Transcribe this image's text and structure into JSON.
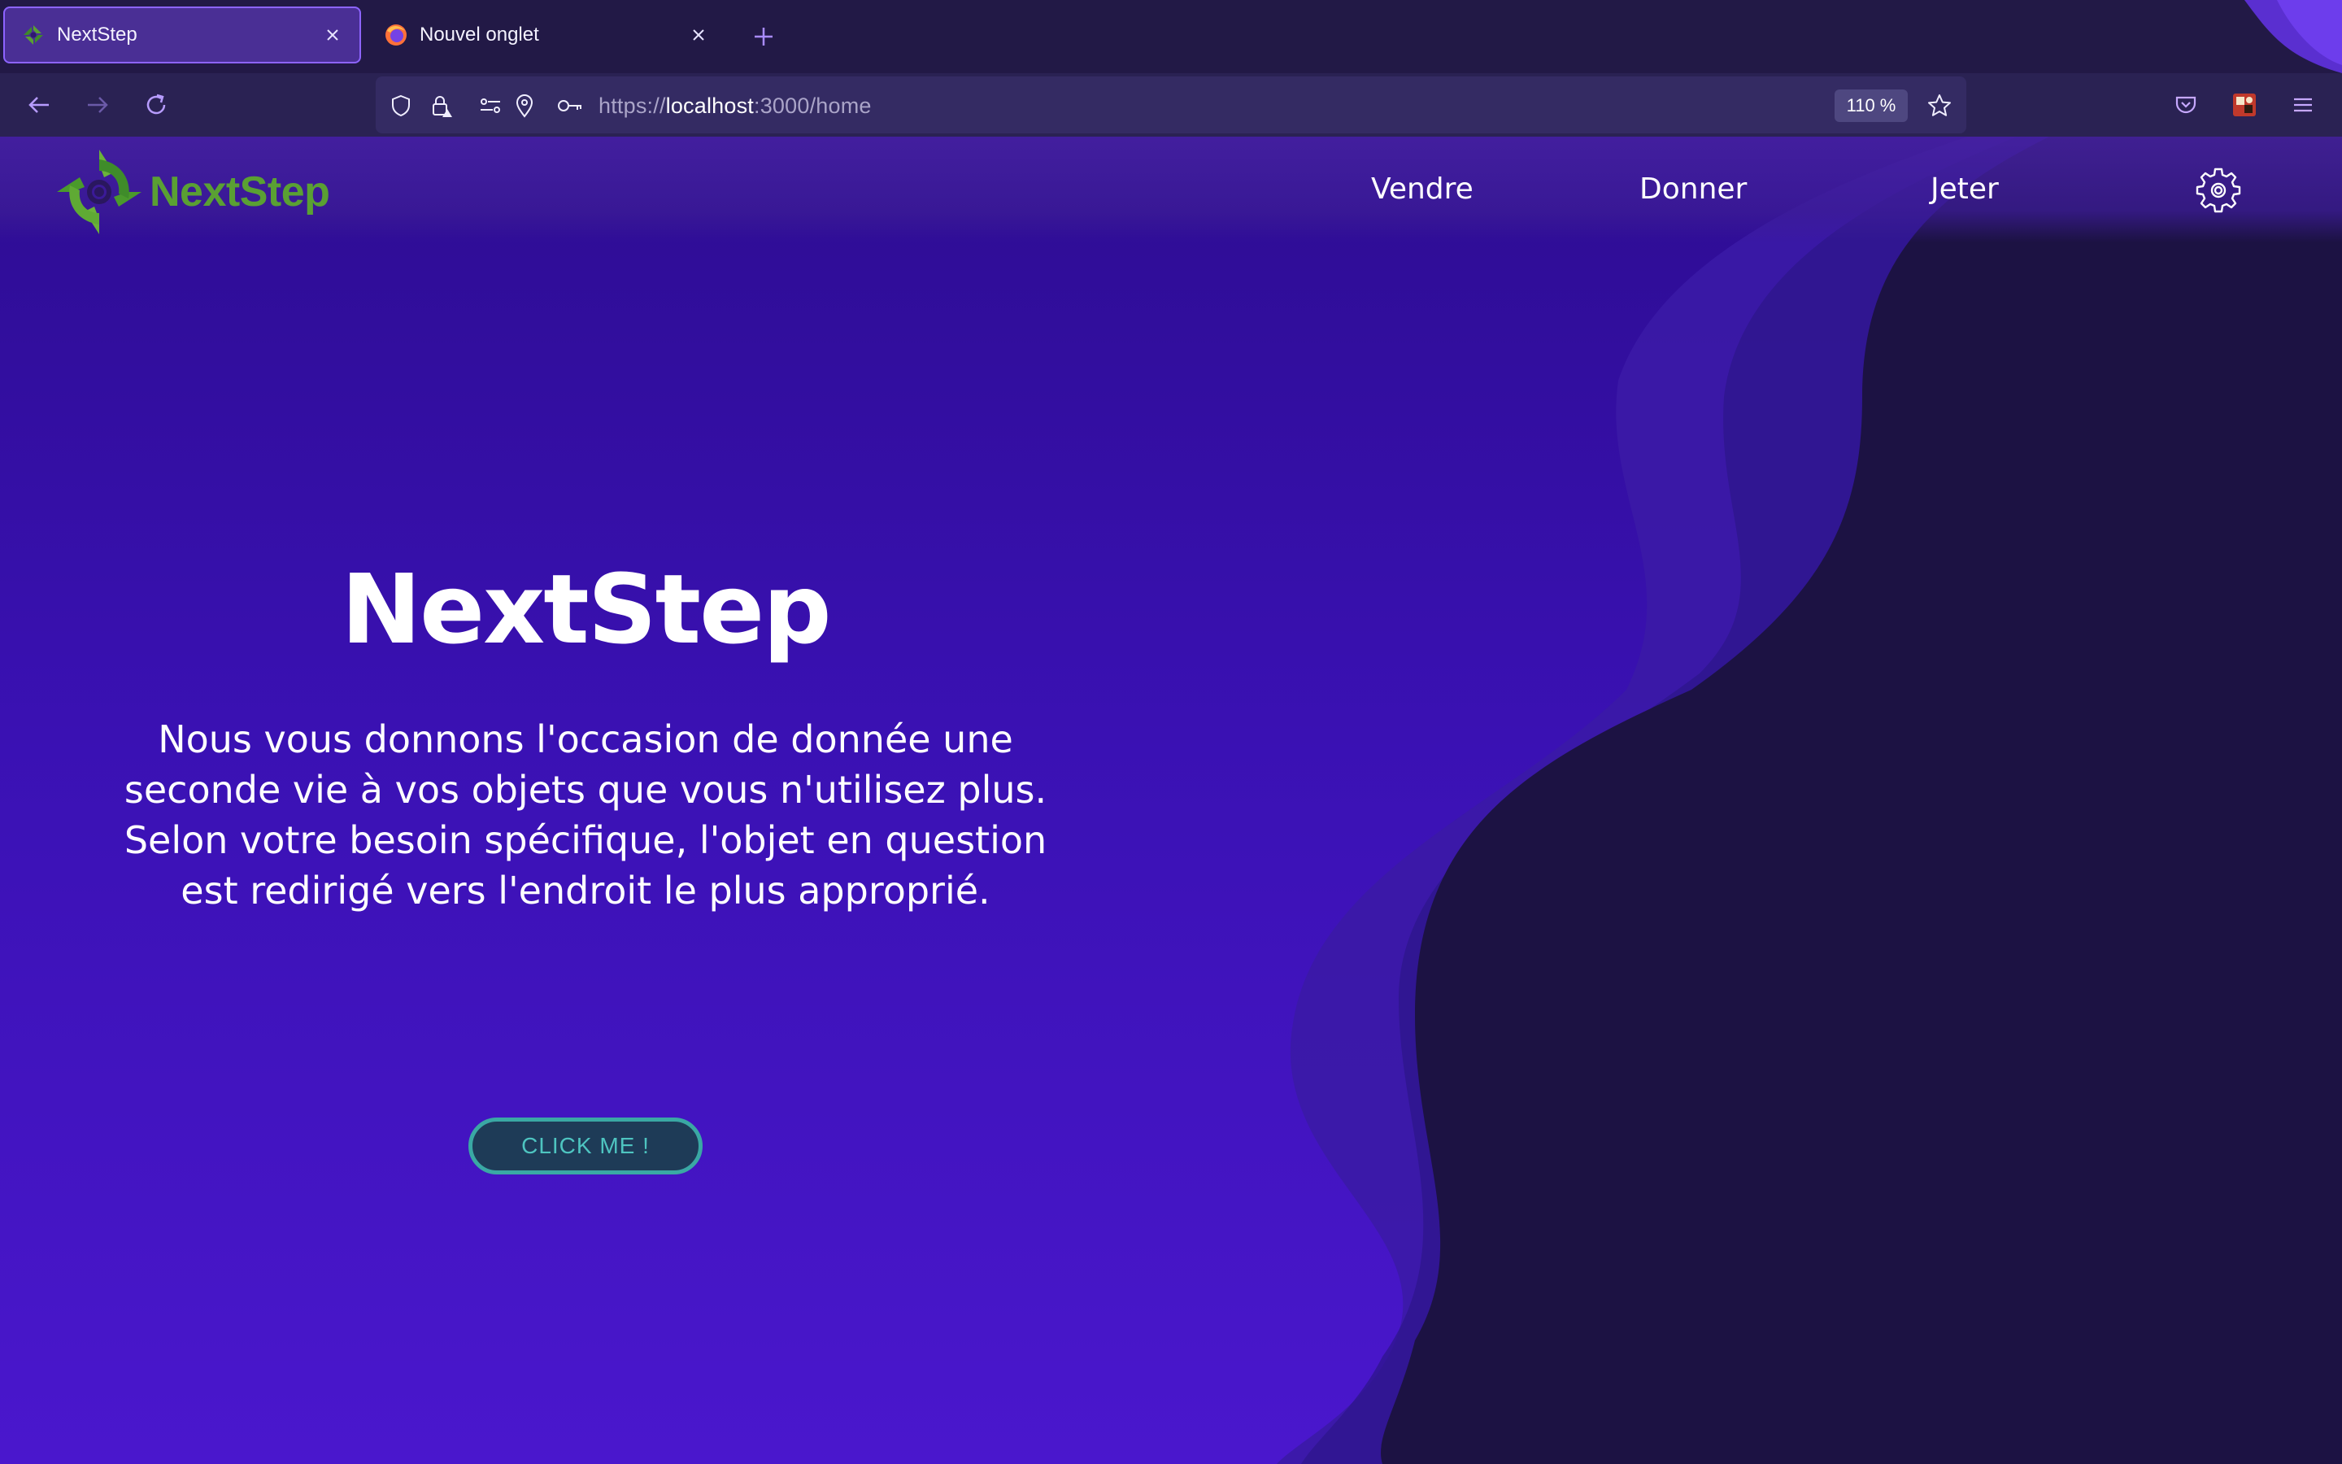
{
  "browser": {
    "tabs": [
      {
        "title": "NextStep",
        "active": true,
        "favicon": "nextstep-logo-icon"
      },
      {
        "title": "Nouvel onglet",
        "active": false,
        "favicon": "firefox-icon"
      }
    ],
    "url": {
      "scheme": "https://",
      "host": "localhost",
      "rest": ":3000/home"
    },
    "zoom": "110 %"
  },
  "site": {
    "brand": "NextStep",
    "brand_color": "#5aa033",
    "nav": [
      "Vendre",
      "Donner",
      "Jeter"
    ],
    "hero": {
      "title": "NextStep",
      "description": "Nous vous donnons l'occasion de donnée une seconde vie à vos objets que vous n'utilisez plus. Selon votre besoin spécifique, l'objet en question est redirigé vers l'endroit le plus approprié.",
      "cta": "CLICK ME !"
    }
  },
  "colors": {
    "accent": "#8d64ff",
    "page_bg_top": "#2d0c92",
    "page_bg_bottom": "#4a17cd",
    "wave_dark": "#1c1243",
    "cta_border": "#3aa8a4"
  }
}
